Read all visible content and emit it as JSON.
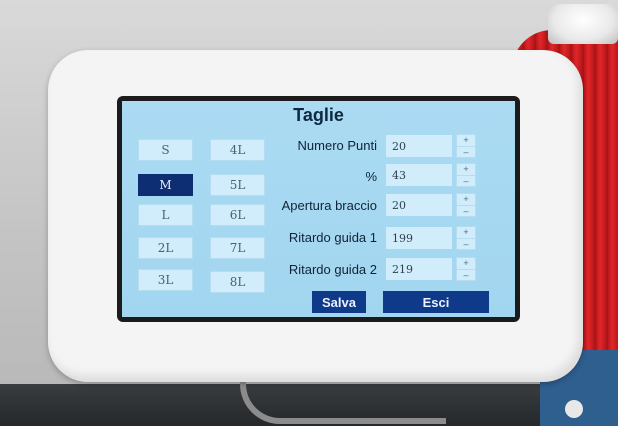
{
  "screen": {
    "title": "Taglie",
    "sizes": [
      {
        "label": "S",
        "selected": false
      },
      {
        "label": "4L",
        "selected": false
      },
      {
        "label": "M",
        "selected": true
      },
      {
        "label": "5L",
        "selected": false
      },
      {
        "label": "L",
        "selected": false
      },
      {
        "label": "6L",
        "selected": false
      },
      {
        "label": "2L",
        "selected": false
      },
      {
        "label": "7L",
        "selected": false
      },
      {
        "label": "3L",
        "selected": false
      },
      {
        "label": "8L",
        "selected": false
      }
    ],
    "params": [
      {
        "label": "Numero Punti",
        "value": "20"
      },
      {
        "label": "%",
        "value": "43"
      },
      {
        "label": "Apertura braccio",
        "value": "20"
      },
      {
        "label": "Ritardo guida 1",
        "value": "199"
      },
      {
        "label": "Ritardo guida 2",
        "value": "219"
      }
    ],
    "stepper": {
      "plus": "+",
      "minus": "–"
    },
    "buttons": {
      "save": "Salva",
      "exit": "Esci"
    }
  },
  "colors": {
    "screen_bg": "#a6d8f1",
    "button_bg": "#d1ecfa",
    "selected_bg": "#0e2e73",
    "action_bg": "#0f3a8a"
  }
}
